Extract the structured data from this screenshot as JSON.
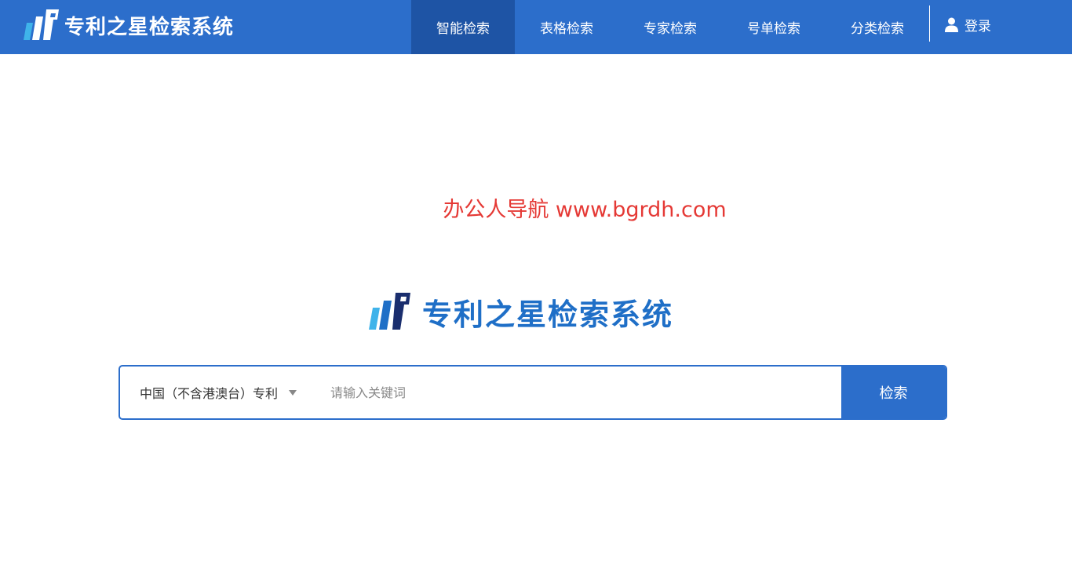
{
  "header": {
    "brand_name": "专利之星检索系统",
    "logo_icon": "patent-star-logo-icon",
    "nav": [
      {
        "label": "智能检索",
        "active": true
      },
      {
        "label": "表格检索",
        "active": false
      },
      {
        "label": "专家检索",
        "active": false
      },
      {
        "label": "号单检索",
        "active": false
      },
      {
        "label": "分类检索",
        "active": false
      }
    ],
    "login_label": "登录",
    "login_icon": "user-icon"
  },
  "watermark": "办公人导航 www.bgrdh.com",
  "main": {
    "brand_name": "专利之星检索系统",
    "search": {
      "scope_label": "中国（不含港澳台）专利",
      "placeholder": "请输入关键词",
      "value": "",
      "button_label": "检索"
    }
  },
  "colors": {
    "header_bg": "#2c6ecb",
    "nav_active_bg": "#1e54a5",
    "brand_blue": "#1f6fc7",
    "watermark_red": "#e53935"
  }
}
